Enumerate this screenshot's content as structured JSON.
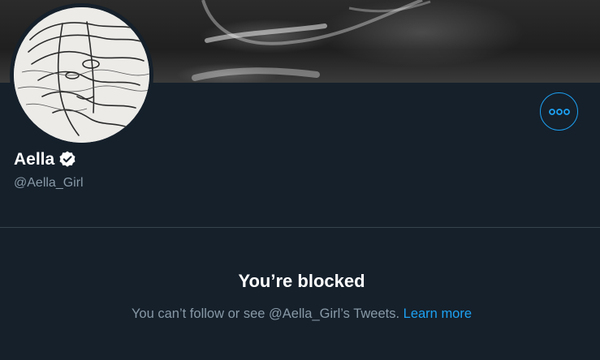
{
  "profile": {
    "display_name": "Aella",
    "handle": "@Aella_Girl",
    "verified": true
  },
  "header": {
    "more_icon": "more-horizontal-icon"
  },
  "blocked": {
    "title": "You’re blocked",
    "message": "You can’t follow or see @Aella_Girl’s Tweets.",
    "link_label": "Learn more"
  },
  "colors": {
    "background": "#15202b",
    "accent": "#1da1f2",
    "secondary_text": "#8899a6",
    "divider": "#38444d"
  }
}
